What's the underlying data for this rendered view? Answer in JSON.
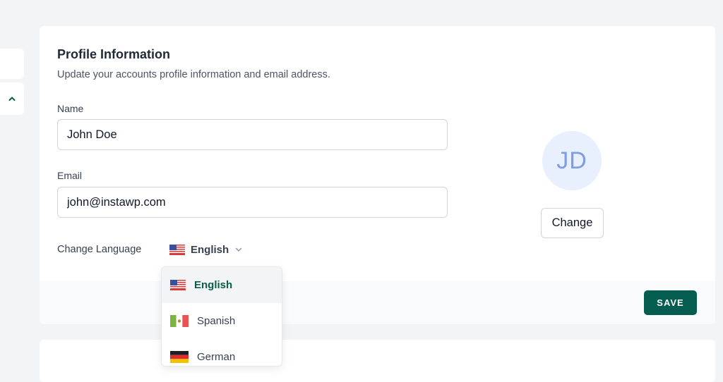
{
  "profile": {
    "title": "Profile Information",
    "subtitle": "Update your accounts profile information and email address.",
    "name_label": "Name",
    "name_value": "John Doe",
    "email_label": "Email",
    "email_value": "john@instawp.com",
    "language_label": "Change Language",
    "selected_language": "English"
  },
  "avatar": {
    "initials": "JD",
    "change_label": "Change"
  },
  "footer": {
    "save_label": "SAVE"
  },
  "language_dropdown": {
    "options": [
      {
        "label": "English",
        "flag": "us-flag-icon"
      },
      {
        "label": "Spanish",
        "flag": "mexico-flag-icon"
      },
      {
        "label": "German",
        "flag": "germany-flag-icon"
      }
    ]
  },
  "colors": {
    "primary": "#045d4e",
    "avatar_bg": "#e8f0fe",
    "avatar_text": "#7f9ce6",
    "page_bg": "#f3f4f6"
  }
}
